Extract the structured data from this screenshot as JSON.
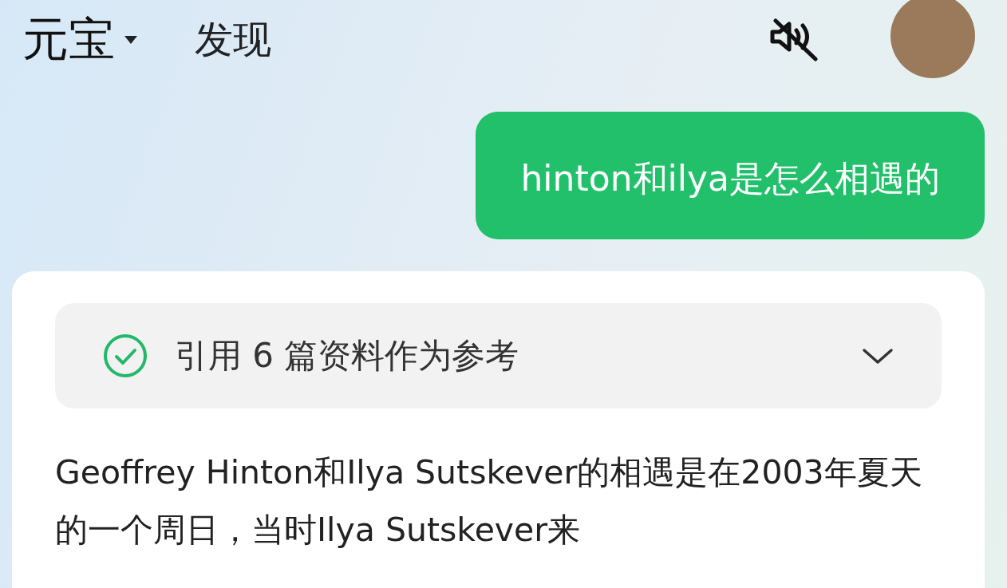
{
  "header": {
    "app_menu": "元宝",
    "tabs": [
      {
        "label": "发现",
        "selected": false
      }
    ],
    "sound_muted": true
  },
  "messages": [
    {
      "kind": "user",
      "text": "hinton和ilya是怎么相遇的"
    },
    {
      "kind": "assistant",
      "references": {
        "label": "引用 6 篇资料作为参考",
        "expanded": false
      },
      "text": "Geoffrey Hinton和Ilya Sutskever的相遇是在2003年夏天的一个周日，当时Ilya Sutskever来"
    }
  ]
}
